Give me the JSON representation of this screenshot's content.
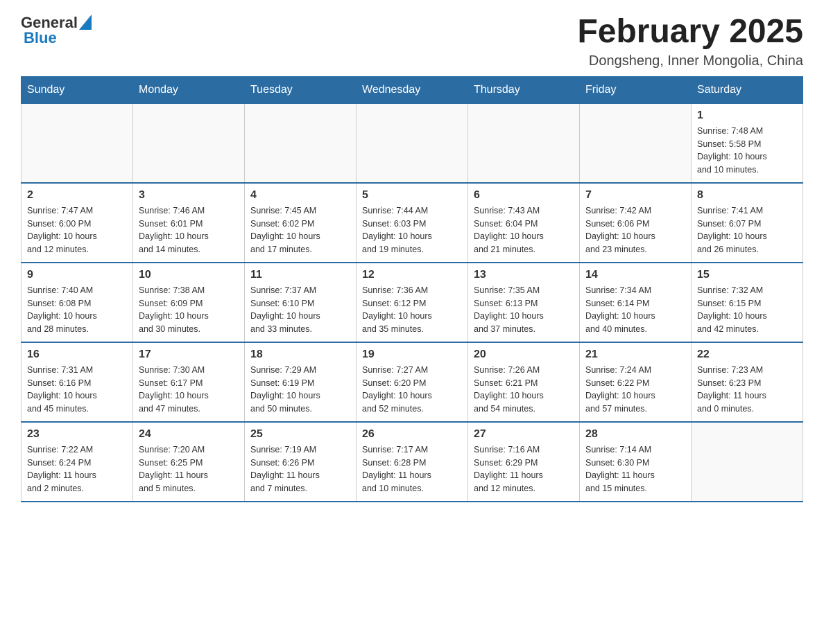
{
  "header": {
    "logo_general": "General",
    "logo_blue": "Blue",
    "month_title": "February 2025",
    "location": "Dongsheng, Inner Mongolia, China"
  },
  "days_of_week": [
    "Sunday",
    "Monday",
    "Tuesday",
    "Wednesday",
    "Thursday",
    "Friday",
    "Saturday"
  ],
  "weeks": [
    [
      {
        "day": "",
        "info": ""
      },
      {
        "day": "",
        "info": ""
      },
      {
        "day": "",
        "info": ""
      },
      {
        "day": "",
        "info": ""
      },
      {
        "day": "",
        "info": ""
      },
      {
        "day": "",
        "info": ""
      },
      {
        "day": "1",
        "info": "Sunrise: 7:48 AM\nSunset: 5:58 PM\nDaylight: 10 hours\nand 10 minutes."
      }
    ],
    [
      {
        "day": "2",
        "info": "Sunrise: 7:47 AM\nSunset: 6:00 PM\nDaylight: 10 hours\nand 12 minutes."
      },
      {
        "day": "3",
        "info": "Sunrise: 7:46 AM\nSunset: 6:01 PM\nDaylight: 10 hours\nand 14 minutes."
      },
      {
        "day": "4",
        "info": "Sunrise: 7:45 AM\nSunset: 6:02 PM\nDaylight: 10 hours\nand 17 minutes."
      },
      {
        "day": "5",
        "info": "Sunrise: 7:44 AM\nSunset: 6:03 PM\nDaylight: 10 hours\nand 19 minutes."
      },
      {
        "day": "6",
        "info": "Sunrise: 7:43 AM\nSunset: 6:04 PM\nDaylight: 10 hours\nand 21 minutes."
      },
      {
        "day": "7",
        "info": "Sunrise: 7:42 AM\nSunset: 6:06 PM\nDaylight: 10 hours\nand 23 minutes."
      },
      {
        "day": "8",
        "info": "Sunrise: 7:41 AM\nSunset: 6:07 PM\nDaylight: 10 hours\nand 26 minutes."
      }
    ],
    [
      {
        "day": "9",
        "info": "Sunrise: 7:40 AM\nSunset: 6:08 PM\nDaylight: 10 hours\nand 28 minutes."
      },
      {
        "day": "10",
        "info": "Sunrise: 7:38 AM\nSunset: 6:09 PM\nDaylight: 10 hours\nand 30 minutes."
      },
      {
        "day": "11",
        "info": "Sunrise: 7:37 AM\nSunset: 6:10 PM\nDaylight: 10 hours\nand 33 minutes."
      },
      {
        "day": "12",
        "info": "Sunrise: 7:36 AM\nSunset: 6:12 PM\nDaylight: 10 hours\nand 35 minutes."
      },
      {
        "day": "13",
        "info": "Sunrise: 7:35 AM\nSunset: 6:13 PM\nDaylight: 10 hours\nand 37 minutes."
      },
      {
        "day": "14",
        "info": "Sunrise: 7:34 AM\nSunset: 6:14 PM\nDaylight: 10 hours\nand 40 minutes."
      },
      {
        "day": "15",
        "info": "Sunrise: 7:32 AM\nSunset: 6:15 PM\nDaylight: 10 hours\nand 42 minutes."
      }
    ],
    [
      {
        "day": "16",
        "info": "Sunrise: 7:31 AM\nSunset: 6:16 PM\nDaylight: 10 hours\nand 45 minutes."
      },
      {
        "day": "17",
        "info": "Sunrise: 7:30 AM\nSunset: 6:17 PM\nDaylight: 10 hours\nand 47 minutes."
      },
      {
        "day": "18",
        "info": "Sunrise: 7:29 AM\nSunset: 6:19 PM\nDaylight: 10 hours\nand 50 minutes."
      },
      {
        "day": "19",
        "info": "Sunrise: 7:27 AM\nSunset: 6:20 PM\nDaylight: 10 hours\nand 52 minutes."
      },
      {
        "day": "20",
        "info": "Sunrise: 7:26 AM\nSunset: 6:21 PM\nDaylight: 10 hours\nand 54 minutes."
      },
      {
        "day": "21",
        "info": "Sunrise: 7:24 AM\nSunset: 6:22 PM\nDaylight: 10 hours\nand 57 minutes."
      },
      {
        "day": "22",
        "info": "Sunrise: 7:23 AM\nSunset: 6:23 PM\nDaylight: 11 hours\nand 0 minutes."
      }
    ],
    [
      {
        "day": "23",
        "info": "Sunrise: 7:22 AM\nSunset: 6:24 PM\nDaylight: 11 hours\nand 2 minutes."
      },
      {
        "day": "24",
        "info": "Sunrise: 7:20 AM\nSunset: 6:25 PM\nDaylight: 11 hours\nand 5 minutes."
      },
      {
        "day": "25",
        "info": "Sunrise: 7:19 AM\nSunset: 6:26 PM\nDaylight: 11 hours\nand 7 minutes."
      },
      {
        "day": "26",
        "info": "Sunrise: 7:17 AM\nSunset: 6:28 PM\nDaylight: 11 hours\nand 10 minutes."
      },
      {
        "day": "27",
        "info": "Sunrise: 7:16 AM\nSunset: 6:29 PM\nDaylight: 11 hours\nand 12 minutes."
      },
      {
        "day": "28",
        "info": "Sunrise: 7:14 AM\nSunset: 6:30 PM\nDaylight: 11 hours\nand 15 minutes."
      },
      {
        "day": "",
        "info": ""
      }
    ]
  ]
}
